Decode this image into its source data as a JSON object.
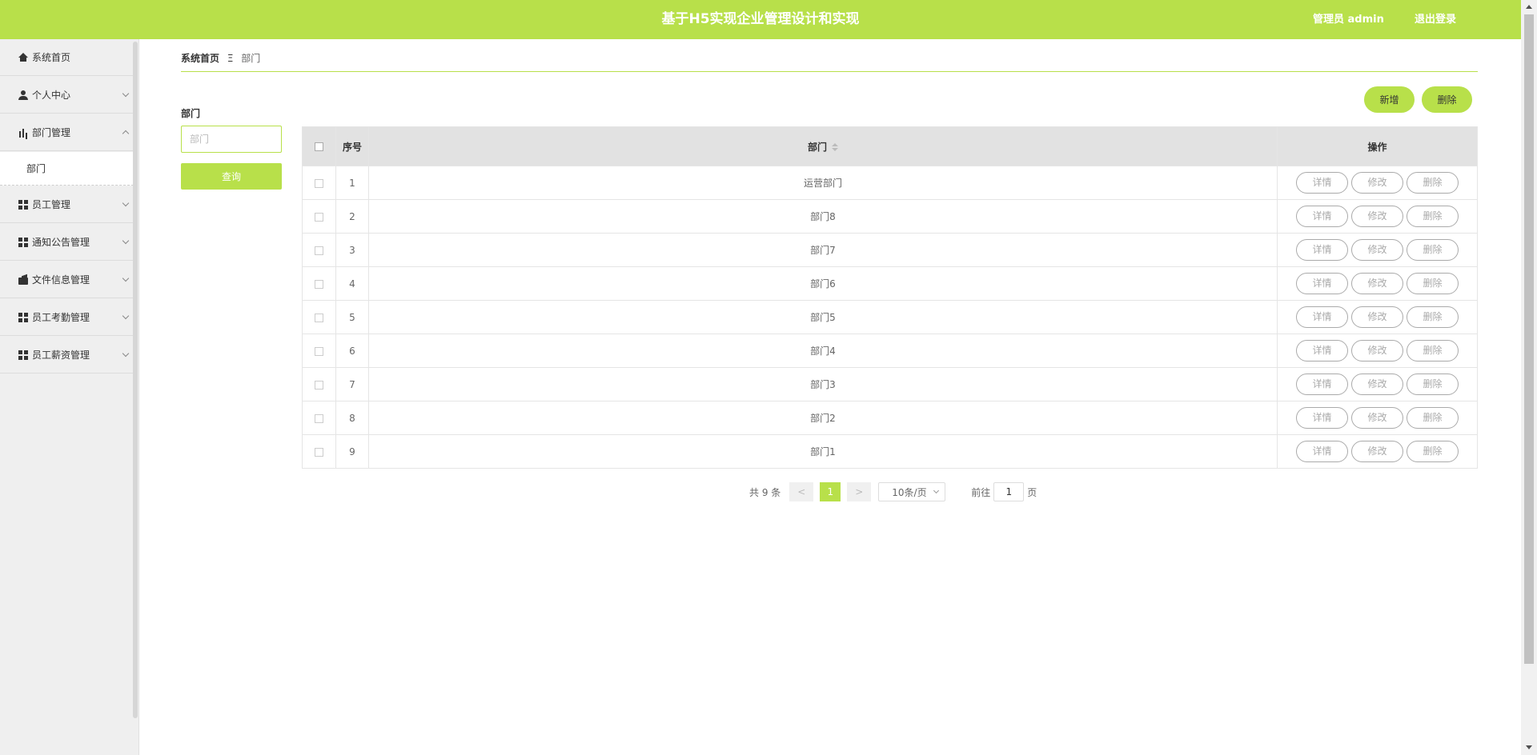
{
  "header": {
    "title": "基于H5实现企业管理设计和实现",
    "user": "管理员 admin",
    "logout": "退出登录"
  },
  "sidebar": {
    "items": [
      {
        "label": "系统首页",
        "icon": "home-icon"
      },
      {
        "label": "个人中心",
        "icon": "user-icon"
      },
      {
        "label": "部门管理",
        "icon": "bar-chart-icon",
        "expanded": true,
        "children": [
          {
            "label": "部门"
          }
        ]
      },
      {
        "label": "员工管理",
        "icon": "grid-icon"
      },
      {
        "label": "通知公告管理",
        "icon": "grid-icon"
      },
      {
        "label": "文件信息管理",
        "icon": "wallet-icon"
      },
      {
        "label": "员工考勤管理",
        "icon": "grid-icon"
      },
      {
        "label": "员工薪资管理",
        "icon": "grid-icon"
      }
    ]
  },
  "breadcrumb": {
    "home": "系统首页",
    "separator": "Ξ",
    "current": "部门"
  },
  "filter": {
    "label": "部门",
    "placeholder": "部门",
    "query_label": "查询"
  },
  "toolbar": {
    "add_label": "新增",
    "delete_label": "删除"
  },
  "table": {
    "headers": {
      "seq": "序号",
      "dept": "部门",
      "ops": "操作"
    },
    "row_actions": {
      "detail": "详情",
      "edit": "修改",
      "delete": "删除"
    },
    "rows": [
      {
        "seq": "1",
        "dept": "运营部门"
      },
      {
        "seq": "2",
        "dept": "部门8"
      },
      {
        "seq": "3",
        "dept": "部门7"
      },
      {
        "seq": "4",
        "dept": "部门6"
      },
      {
        "seq": "5",
        "dept": "部门5"
      },
      {
        "seq": "6",
        "dept": "部门4"
      },
      {
        "seq": "7",
        "dept": "部门3"
      },
      {
        "seq": "8",
        "dept": "部门2"
      },
      {
        "seq": "9",
        "dept": "部门1"
      }
    ]
  },
  "pagination": {
    "total": "共 9 条",
    "prev": "<",
    "current_page": "1",
    "next": ">",
    "page_size": "10条/页",
    "goto_label": "前往",
    "goto_value": "1",
    "page_suffix": "页"
  },
  "colors": {
    "accent": "#b8e04a",
    "header_bg": "#b8e04a",
    "sidebar_bg": "#efefef",
    "table_header_bg": "#e2e2e2"
  }
}
